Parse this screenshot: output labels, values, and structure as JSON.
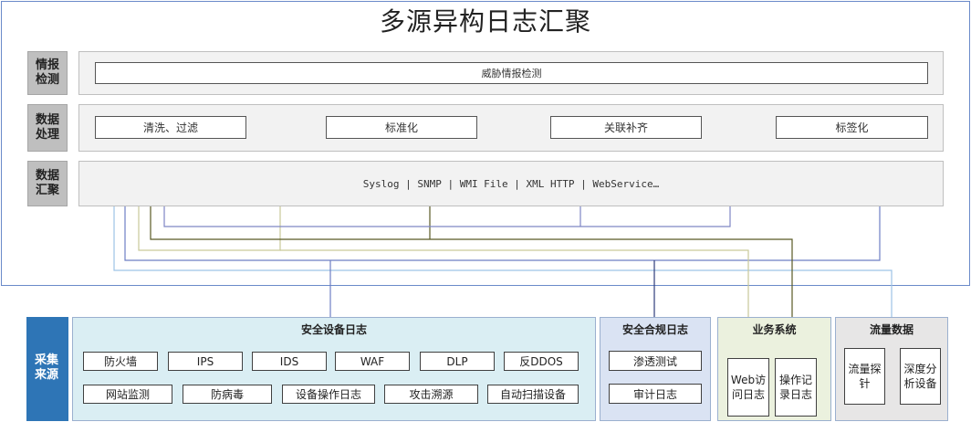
{
  "title": "多源异构日志汇聚",
  "rows": {
    "intel": {
      "label": "情报检测",
      "items": [
        "威胁情报检测"
      ]
    },
    "process": {
      "label": "数据处理",
      "items": [
        "清洗、过滤",
        "标准化",
        "关联补齐",
        "标签化"
      ]
    },
    "collect": {
      "label": "数据汇聚",
      "protocols": "Syslog | SNMP | WMI File | XML HTTP | WebService…"
    }
  },
  "sources": {
    "label": "采集来源",
    "security_devices": {
      "title": "安全设备日志",
      "row1": [
        "防火墙",
        "IPS",
        "IDS",
        "WAF",
        "DLP",
        "反DDOS"
      ],
      "row2": [
        "网站监测",
        "防病毒",
        "设备操作日志",
        "攻击溯源",
        "自动扫描设备"
      ]
    },
    "compliance": {
      "title": "安全合规日志",
      "items": [
        "渗透测试",
        "审计日志"
      ]
    },
    "business": {
      "title": "业务系统",
      "items": [
        "Web访问日志",
        "操作记录日志"
      ]
    },
    "traffic": {
      "title": "流量数据",
      "items": [
        "流量探针",
        "深度分析设备"
      ]
    }
  },
  "colors": {
    "frame_border": "#6b8ac9",
    "source_label_bg": "#2e75b6",
    "security_panel_bg": "#daeef3",
    "compliance_panel_bg": "#dae3f3",
    "business_panel_bg": "#ebf1de",
    "traffic_panel_bg": "#e7e6e6"
  }
}
